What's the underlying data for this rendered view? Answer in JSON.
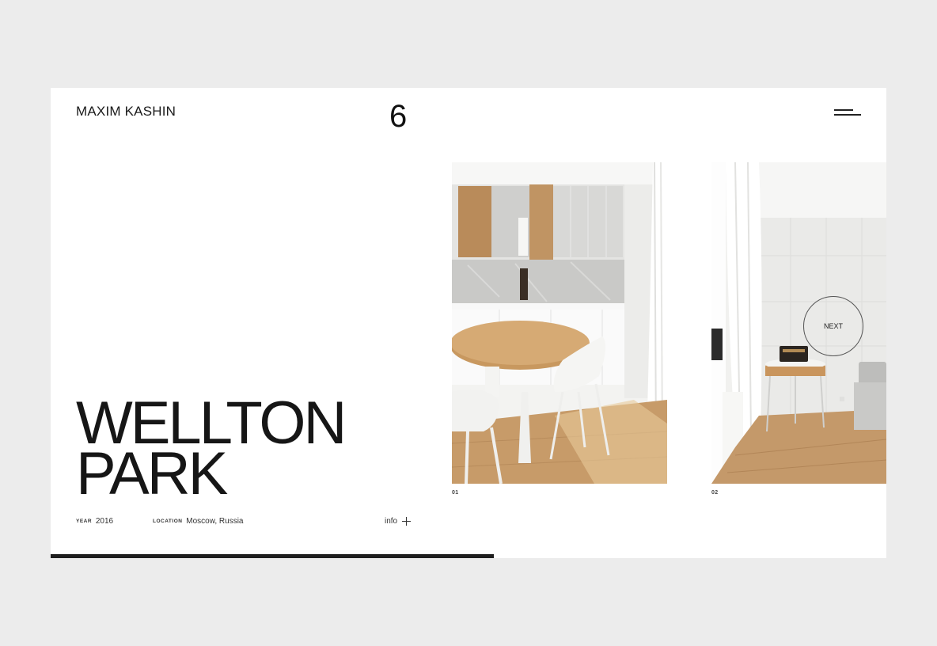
{
  "header": {
    "brand": "MAXIM KASHIN",
    "project_number": "6",
    "menu_icon": "hamburger-menu-icon"
  },
  "project": {
    "title_line1": "WELLTON",
    "title_line2": "PARK",
    "year_label": "YEAR",
    "year_value": "2016",
    "location_label": "LOCATION",
    "location_value": "Moscow, Russia",
    "info_label": "info",
    "info_icon": "plus-icon"
  },
  "gallery": {
    "photos": [
      {
        "caption": "01",
        "alt": "kitchen with round wooden table and white chairs"
      },
      {
        "caption": "02",
        "alt": "living room with white curtains, side table and radio"
      }
    ],
    "next_label": "NEXT"
  },
  "progress": {
    "percent": 53
  },
  "colors": {
    "background": "#ececec",
    "card": "#ffffff",
    "text": "#1a1a1a",
    "progress": "#1e1e1e"
  }
}
